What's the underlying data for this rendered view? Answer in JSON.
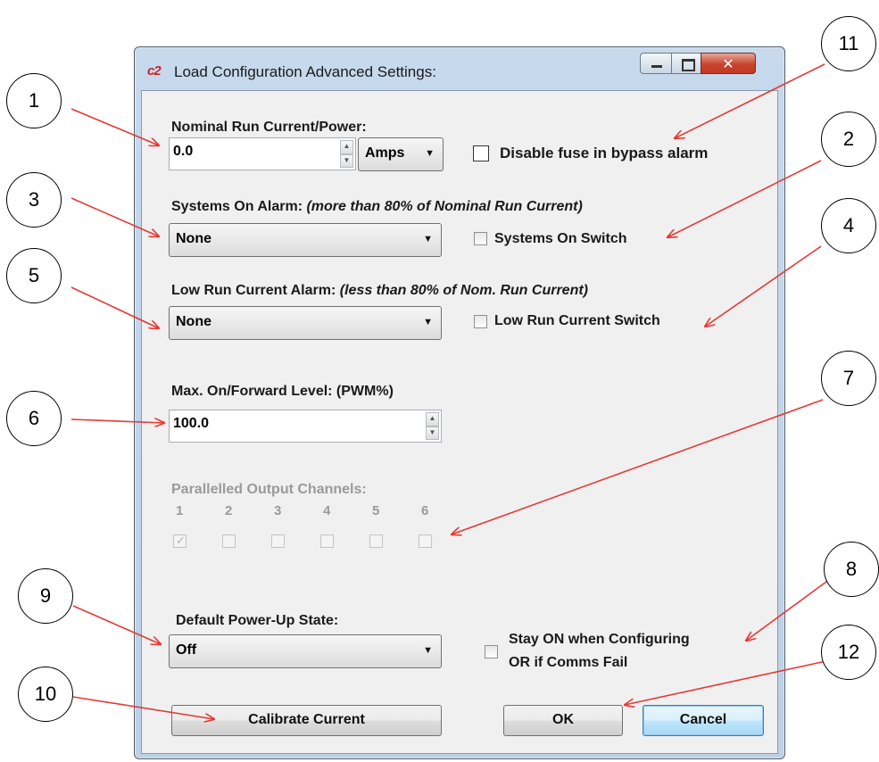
{
  "dialog": {
    "title": "Load Configuration Advanced Settings:",
    "logo": "c2",
    "window_controls": [
      "minimize",
      "maximize",
      "close"
    ]
  },
  "nominal": {
    "label": "Nominal Run Current/Power:",
    "value": "0.0",
    "unit": "Amps",
    "fuse_label": "Disable fuse in bypass alarm",
    "fuse_checked": false
  },
  "systems_on": {
    "label": "Systems On Alarm:",
    "note": "(more than 80% of Nominal Run Current)",
    "value": "None",
    "switch_label": "Systems On Switch",
    "switch_checked": false
  },
  "low_run": {
    "label": "Low Run Current Alarm:",
    "note": "(less than 80% of Nom. Run Current)",
    "value": "None",
    "switch_label": "Low Run Current Switch",
    "switch_checked": false
  },
  "max_level": {
    "label": "Max. On/Forward Level: (PWM%)",
    "value": "100.0"
  },
  "parallel": {
    "label": "Parallelled Output Channels:",
    "channels": [
      "1",
      "2",
      "3",
      "4",
      "5",
      "6"
    ],
    "checked": [
      true,
      false,
      false,
      false,
      false,
      false
    ]
  },
  "power_up": {
    "label": "Default Power-Up State:",
    "value": "Off",
    "stay_on_line1": "Stay ON when Configuring",
    "stay_on_line2": "OR if Comms Fail",
    "stay_on_checked": false
  },
  "buttons": {
    "calibrate": "Calibrate Current",
    "ok": "OK",
    "cancel": "Cancel"
  },
  "callouts": [
    "1",
    "2",
    "3",
    "4",
    "5",
    "6",
    "7",
    "8",
    "9",
    "10",
    "11",
    "12"
  ],
  "colors": {
    "arrow": "#e53935",
    "title_bar": "#bcd0e6",
    "close_button": "#c7442e"
  }
}
